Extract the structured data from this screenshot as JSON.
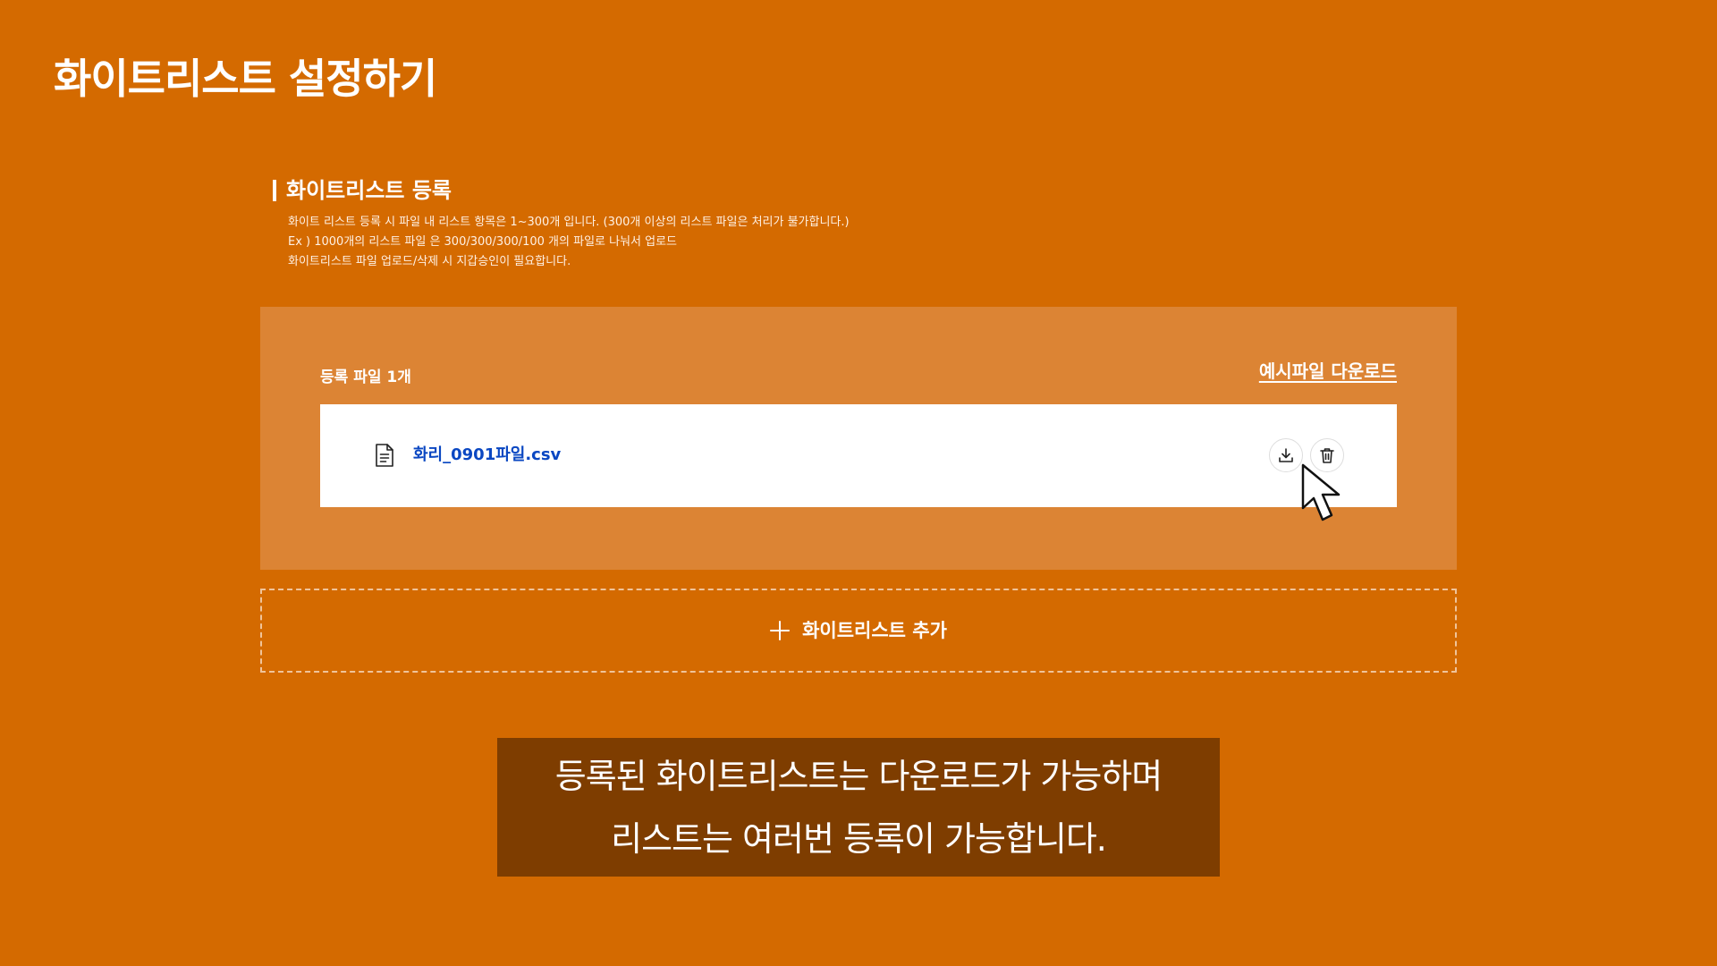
{
  "page": {
    "title": "화이트리스트 설정하기"
  },
  "section": {
    "title": "화이트리스트 등록",
    "notes": [
      "화이트 리스트 등록 시 파일 내 리스트 항목은 1~300개 입니다. (300개 이상의 리스트 파일은 처리가 불가합니다.)",
      "Ex ) 1000개의 리스트 파일 은 300/300/300/100 개의 파일로 나눠서 업로드",
      "화이트리스트 파일 업로드/삭제 시 지갑승인이 필요합니다."
    ]
  },
  "panel": {
    "file_count_label": "등록 파일 1개",
    "sample_download_label": "예시파일 다운로드",
    "file": {
      "name": "화리_0901파일.csv",
      "icon": "document-icon",
      "actions": [
        "download-icon",
        "trash-icon"
      ]
    }
  },
  "add_button": {
    "label": "화이트리스트 추가",
    "icon": "plus-icon"
  },
  "caption": {
    "lines": [
      "등록된 화이트리스트는 다운로드가 가능하며",
      "리스트는 여러번 등록이 가능합니다."
    ]
  },
  "colors": {
    "background": "#D46A00",
    "panel": "#DC8434",
    "caption_background": "#7E3D00",
    "file_link": "#0A47C2",
    "text": "#FFFFFF"
  }
}
